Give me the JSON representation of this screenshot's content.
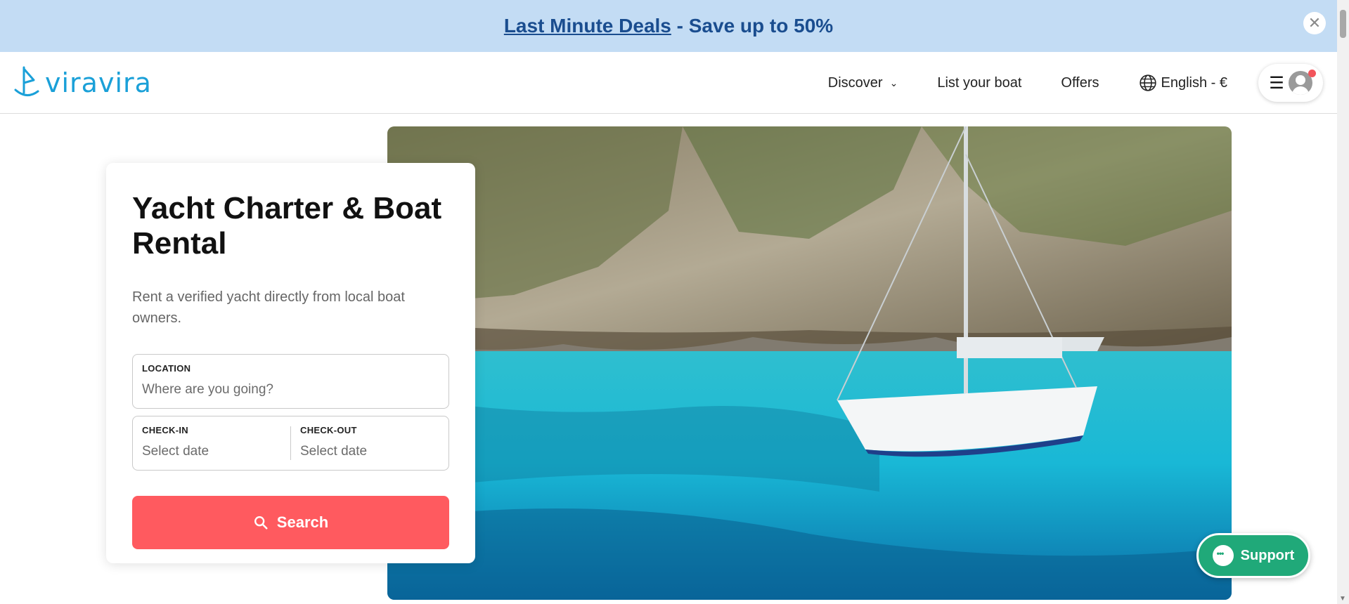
{
  "banner": {
    "link_text": "Last Minute Deals",
    "rest_text": " - Save up to 50%",
    "close_label": "✕"
  },
  "header": {
    "logo_text": "viravira",
    "nav": {
      "discover": "Discover",
      "list_boat": "List your boat",
      "offers": "Offers",
      "language": "English - €"
    },
    "menu_icon": "☰"
  },
  "search_card": {
    "title": "Yacht Charter & Boat Rental",
    "subtitle": "Rent a verified yacht directly from local boat owners.",
    "location_label": "LOCATION",
    "location_placeholder": "Where are you going?",
    "checkin_label": "CHECK-IN",
    "checkin_placeholder": "Select date",
    "checkout_label": "CHECK-OUT",
    "checkout_placeholder": "Select date",
    "search_label": "Search"
  },
  "support": {
    "label": "Support"
  },
  "colors": {
    "banner_bg": "#c3dcf4",
    "banner_text": "#1a4d8f",
    "brand": "#1aa0d8",
    "search_button": "#ff5a5f",
    "support_button": "#20a979"
  },
  "icons": [
    "close-icon",
    "chevron-down-icon",
    "globe-icon",
    "hamburger-icon",
    "avatar-icon",
    "search-icon",
    "chat-icon"
  ]
}
